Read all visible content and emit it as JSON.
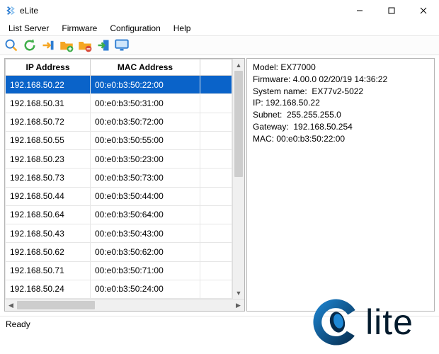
{
  "window": {
    "title": "eLite",
    "status": "Ready"
  },
  "menu": {
    "list_server": "List Server",
    "firmware": "Firmware",
    "configuration": "Configuration",
    "help": "Help"
  },
  "toolbar_icons": [
    "search",
    "refresh",
    "export",
    "folder-add",
    "folder-remove",
    "login",
    "monitor"
  ],
  "table": {
    "headers": {
      "ip": "IP Address",
      "mac": "MAC Address"
    },
    "rows": [
      {
        "ip": "192.168.50.22",
        "mac": "00:e0:b3:50:22:00",
        "selected": true
      },
      {
        "ip": "192.168.50.31",
        "mac": "00:e0:b3:50:31:00",
        "selected": false
      },
      {
        "ip": "192.168.50.72",
        "mac": "00:e0:b3:50:72:00",
        "selected": false
      },
      {
        "ip": "192.168.50.55",
        "mac": "00:e0:b3:50:55:00",
        "selected": false
      },
      {
        "ip": "192.168.50.23",
        "mac": "00:e0:b3:50:23:00",
        "selected": false
      },
      {
        "ip": "192.168.50.73",
        "mac": "00:e0:b3:50:73:00",
        "selected": false
      },
      {
        "ip": "192.168.50.44",
        "mac": "00:e0:b3:50:44:00",
        "selected": false
      },
      {
        "ip": "192.168.50.64",
        "mac": "00:e0:b3:50:64:00",
        "selected": false
      },
      {
        "ip": "192.168.50.43",
        "mac": "00:e0:b3:50:43:00",
        "selected": false
      },
      {
        "ip": "192.168.50.62",
        "mac": "00:e0:b3:50:62:00",
        "selected": false
      },
      {
        "ip": "192.168.50.71",
        "mac": "00:e0:b3:50:71:00",
        "selected": false
      },
      {
        "ip": "192.168.50.24",
        "mac": "00:e0:b3:50:24:00",
        "selected": false
      }
    ]
  },
  "details": {
    "model_label": "Model:",
    "model": "EX77000",
    "firmware_label": "Firmware:",
    "firmware": "4.00.0 02/20/19 14:36:22",
    "sysname_label": "System name:",
    "sysname": "EX77v2-5022",
    "ip_label": "IP:",
    "ip": "192.168.50.22",
    "subnet_label": "Subnet:",
    "subnet": "255.255.255.0",
    "gateway_label": "Gateway:",
    "gateway": "192.168.50.254",
    "mac_label": "MAC:",
    "mac": "00:e0:b3:50:22:00"
  },
  "logo": {
    "text": "lite"
  },
  "colors": {
    "selection": "#0a63c9",
    "logo_dark": "#062a4a",
    "logo_light": "#1e88d6"
  }
}
